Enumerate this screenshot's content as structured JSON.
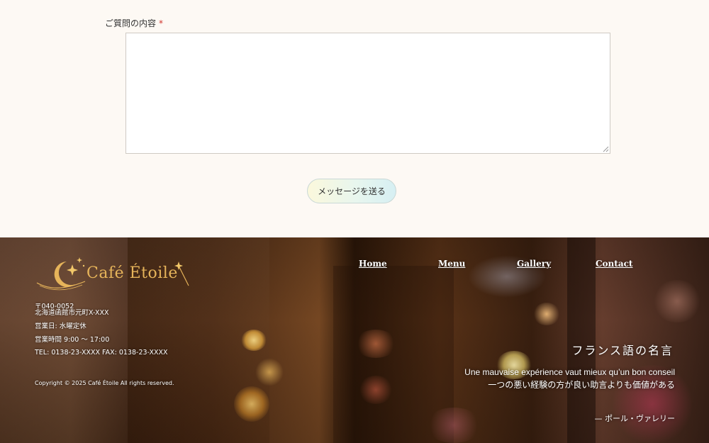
{
  "form": {
    "inquiry_label": "ご質問の内容",
    "required_mark": "*",
    "inquiry_value": "",
    "submit_label": "メッセージを送る"
  },
  "footer": {
    "logo_text": "Café Étoile",
    "nav": [
      {
        "label": "Home"
      },
      {
        "label": "Menu"
      },
      {
        "label": "Gallery"
      },
      {
        "label": "Contact"
      }
    ],
    "postal_code": "〒040-0052",
    "address": "北海道函館市元町X-XXX",
    "closed_day": "営業日: 水曜定休",
    "hours": "営業時間 9:00 〜 17:00",
    "phone_fax": "TEL: 0138-23-XXXX FAX: 0138-23-XXXX",
    "copyright": "Copyright © 2025 Café Étoile All rights reserved.",
    "quote": {
      "title": "フランス語の名言",
      "french": "Une mauvaise expérience vaut mieux qu’un bon conseil",
      "japanese": "一つの悪い経験の方が良い助言よりも価値がある",
      "author": "— ポール・ヴァレリー"
    }
  },
  "colors": {
    "page_bg": "#fdf9f4",
    "required": "#d0342c",
    "logo_gold": "#e6b45a",
    "footer_text": "#ffffff"
  },
  "icons": [
    "crescent-moon-icon",
    "star-icon",
    "magic-wand-icon",
    "resize-grip-icon"
  ]
}
